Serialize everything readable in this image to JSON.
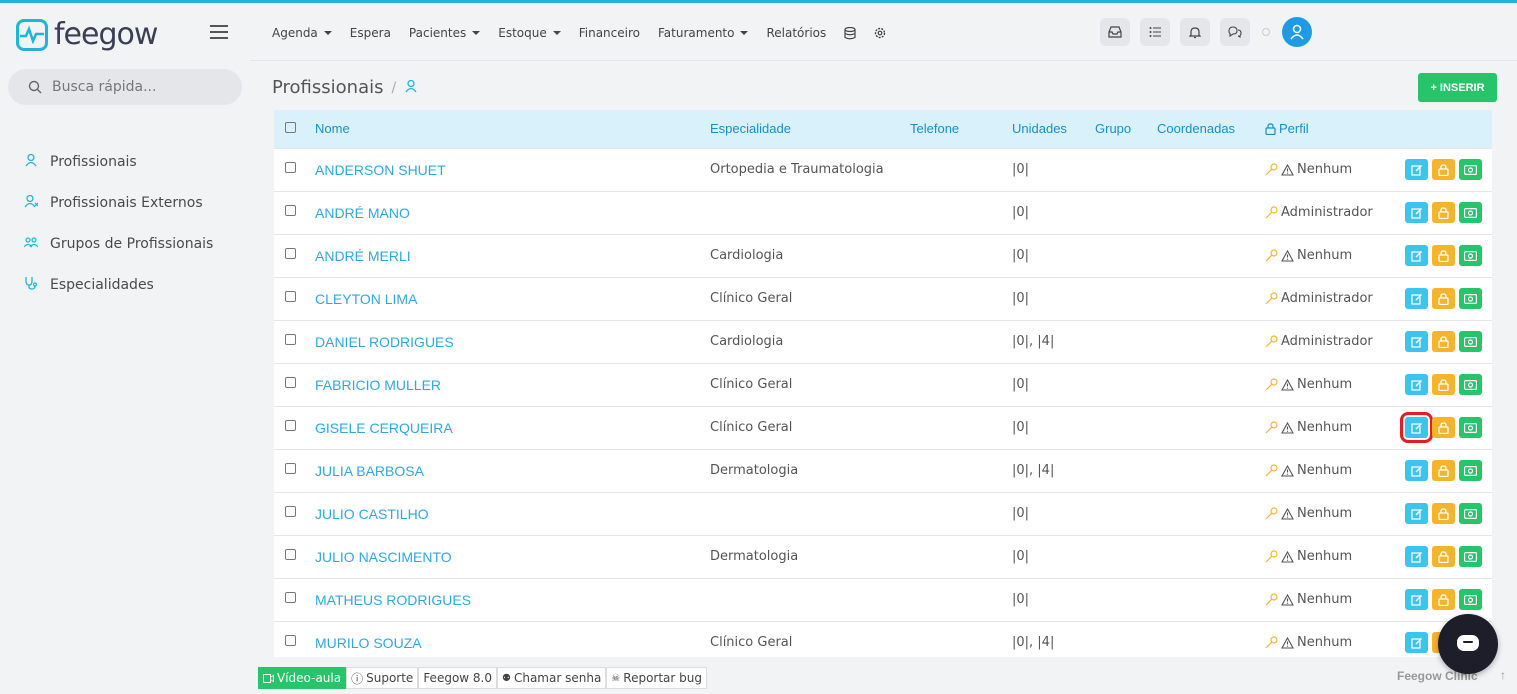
{
  "brand": {
    "name": "feegow"
  },
  "search": {
    "placeholder": "Busca rápida..."
  },
  "sidebar": {
    "items": [
      {
        "label": "Profissionais",
        "icon": "user-icon"
      },
      {
        "label": "Profissionais Externos",
        "icon": "user-plus-icon"
      },
      {
        "label": "Grupos de Profissionais",
        "icon": "group-icon"
      },
      {
        "label": "Especialidades",
        "icon": "stethoscope-icon"
      }
    ]
  },
  "topnav": {
    "items": [
      {
        "label": "Agenda",
        "dropdown": true
      },
      {
        "label": "Espera",
        "dropdown": false
      },
      {
        "label": "Pacientes",
        "dropdown": true
      },
      {
        "label": "Estoque",
        "dropdown": true
      },
      {
        "label": "Financeiro",
        "dropdown": false
      },
      {
        "label": "Faturamento",
        "dropdown": true
      },
      {
        "label": "Relatórios",
        "dropdown": false
      }
    ]
  },
  "page": {
    "title": "Profissionais",
    "insert_label": "+ INSERIR"
  },
  "table": {
    "headers": {
      "nome": "Nome",
      "especialidade": "Especialidade",
      "telefone": "Telefone",
      "unidades": "Unidades",
      "grupo": "Grupo",
      "coordenadas": "Coordenadas",
      "perfil": "Perfil"
    },
    "rows": [
      {
        "nome": "ANDERSON SHUET",
        "especialidade": "Ortopedia e Traumatologia",
        "unidades": "|0|",
        "perfil": "Nenhum",
        "warn": true
      },
      {
        "nome": "ANDRÉ MANO",
        "especialidade": "",
        "unidades": "|0|",
        "perfil": "Administrador",
        "warn": false
      },
      {
        "nome": "ANDRÉ MERLI",
        "especialidade": "Cardiologia",
        "unidades": "|0|",
        "perfil": "Nenhum",
        "warn": true
      },
      {
        "nome": "CLEYTON LIMA",
        "especialidade": "Clínico Geral",
        "unidades": "|0|",
        "perfil": "Administrador",
        "warn": false
      },
      {
        "nome": "DANIEL RODRIGUES",
        "especialidade": "Cardiologia",
        "unidades": "|0|, |4|",
        "perfil": "Administrador",
        "warn": false
      },
      {
        "nome": "FABRICIO MULLER",
        "especialidade": "Clínico Geral",
        "unidades": "|0|",
        "perfil": "Nenhum",
        "warn": true
      },
      {
        "nome": "GISELE CERQUEIRA",
        "especialidade": "Clínico Geral",
        "unidades": "|0|",
        "perfil": "Nenhum",
        "warn": true,
        "highlight": true
      },
      {
        "nome": "JULIA BARBOSA",
        "especialidade": "Dermatologia",
        "unidades": "|0|, |4|",
        "perfil": "Nenhum",
        "warn": true
      },
      {
        "nome": "JULIO CASTILHO",
        "especialidade": "",
        "unidades": "|0|",
        "perfil": "Nenhum",
        "warn": true
      },
      {
        "nome": "JULIO NASCIMENTO",
        "especialidade": "Dermatologia",
        "unidades": "|0|",
        "perfil": "Nenhum",
        "warn": true
      },
      {
        "nome": "MATHEUS RODRIGUES",
        "especialidade": "",
        "unidades": "|0|",
        "perfil": "Nenhum",
        "warn": true
      },
      {
        "nome": "MURILO SOUZA",
        "especialidade": "Clínico Geral",
        "unidades": "|0|, |4|",
        "perfil": "Nenhum",
        "warn": true
      }
    ]
  },
  "bottombar": {
    "video": "Vídeo-aula",
    "suporte": "Suporte",
    "version": "Feegow 8.0",
    "chamar": "Chamar senha",
    "bug": "Reportar bug",
    "brand": "Feegow Clinic"
  },
  "colors": {
    "accent": "#1fb5d9",
    "success": "#27c46a",
    "warning": "#f5b42c",
    "info": "#3cc4ec",
    "highlight": "#e51c23"
  }
}
